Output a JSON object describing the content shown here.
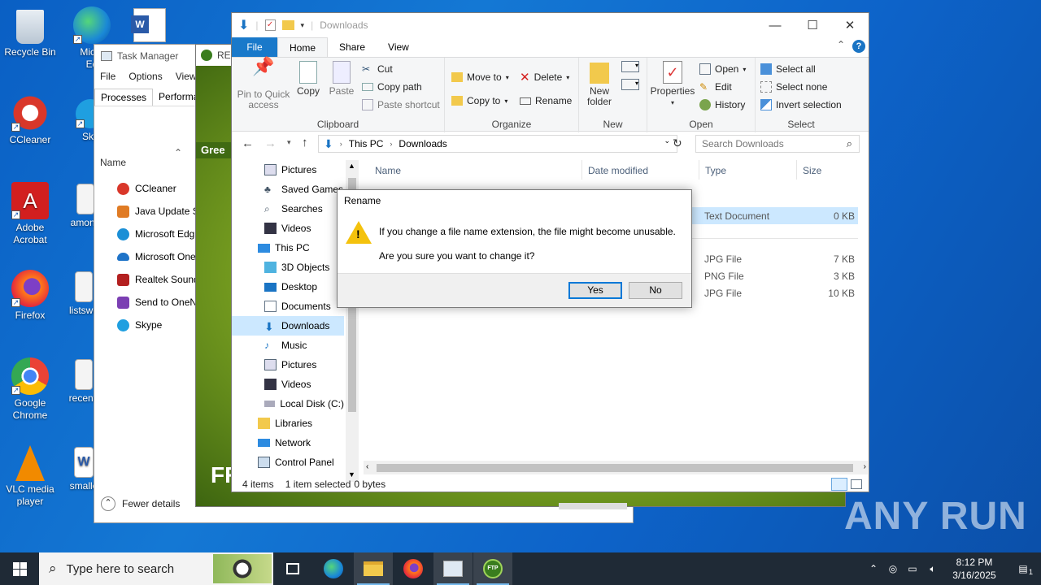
{
  "desktop": {
    "icons": [
      {
        "label": "Recycle Bin",
        "icon": "recycle-bin-icon"
      },
      {
        "label": "Micro\nEd",
        "icon": "edge-icon"
      },
      {
        "label": "CCleaner",
        "icon": "ccleaner-icon"
      },
      {
        "label": "Sky",
        "icon": "skype-icon"
      },
      {
        "label": "Adobe Acrobat",
        "icon": "acrobat-icon"
      },
      {
        "label": "among",
        "icon": "file-icon"
      },
      {
        "label": "Firefox",
        "icon": "firefox-icon"
      },
      {
        "label": "listswo",
        "icon": "file-icon"
      },
      {
        "label": "Google Chrome",
        "icon": "chrome-icon"
      },
      {
        "label": "recentf",
        "icon": "file-icon"
      },
      {
        "label": "VLC media player",
        "icon": "vlc-icon"
      },
      {
        "label": "smalle",
        "icon": "word-icon"
      }
    ]
  },
  "task_manager": {
    "title": "Task Manager",
    "menu": [
      "File",
      "Options",
      "View"
    ],
    "tabs": [
      "Processes",
      "Performan"
    ],
    "column": "Name",
    "items": [
      {
        "label": "CCleaner",
        "color": "#d9372a"
      },
      {
        "label": "Java Update Sc",
        "color": "#e07b24"
      },
      {
        "label": "Microsoft Edg",
        "color": "#1b8fd6"
      },
      {
        "label": "Microsoft One",
        "color": "#1e73c8"
      },
      {
        "label": "Realtek Sound",
        "color": "#b32020"
      },
      {
        "label": "Send to OneN",
        "color": "#7b3fb3"
      },
      {
        "label": "Skype",
        "color": "#1f9fe0"
      }
    ],
    "footer": "Fewer details"
  },
  "green_window": {
    "title": "REF",
    "band_text": "Gree",
    "bottom_text": "FR"
  },
  "explorer": {
    "title": "Downloads",
    "tabs": {
      "file": "File",
      "home": "Home",
      "share": "Share",
      "view": "View"
    },
    "ribbon": {
      "clipboard": {
        "pin": "Pin to Quick access",
        "copy": "Copy",
        "paste": "Paste",
        "cut": "Cut",
        "copy_path": "Copy path",
        "paste_shortcut": "Paste shortcut",
        "label": "Clipboard"
      },
      "organize": {
        "move_to": "Move to",
        "copy_to": "Copy to",
        "delete": "Delete",
        "rename": "Rename",
        "label": "Organize"
      },
      "new": {
        "new_folder": "New folder",
        "label": "New"
      },
      "open": {
        "properties": "Properties",
        "open": "Open",
        "edit": "Edit",
        "history": "History",
        "label": "Open"
      },
      "select": {
        "select_all": "Select all",
        "select_none": "Select none",
        "invert_selection": "Invert selection",
        "label": "Select"
      }
    },
    "address": {
      "segments": [
        "This PC",
        "Downloads"
      ],
      "search_placeholder": "Search Downloads"
    },
    "nav": [
      {
        "label": "Pictures",
        "icon": "pictures-icon",
        "indent": 1
      },
      {
        "label": "Saved Games",
        "icon": "saved-games-icon",
        "indent": 1
      },
      {
        "label": "Searches",
        "icon": "searches-icon",
        "indent": 1
      },
      {
        "label": "Videos",
        "icon": "videos-icon",
        "indent": 1
      },
      {
        "label": "This PC",
        "icon": "this-pc-icon",
        "indent": 0
      },
      {
        "label": "3D Objects",
        "icon": "3d-objects-icon",
        "indent": 1
      },
      {
        "label": "Desktop",
        "icon": "desktop-icon",
        "indent": 1
      },
      {
        "label": "Documents",
        "icon": "documents-icon",
        "indent": 1
      },
      {
        "label": "Downloads",
        "icon": "downloads-icon",
        "indent": 1,
        "selected": true
      },
      {
        "label": "Music",
        "icon": "music-icon",
        "indent": 1
      },
      {
        "label": "Pictures",
        "icon": "pictures-icon",
        "indent": 1
      },
      {
        "label": "Videos",
        "icon": "videos-icon",
        "indent": 1
      },
      {
        "label": "Local Disk (C:)",
        "icon": "disk-icon",
        "indent": 1
      },
      {
        "label": "Libraries",
        "icon": "libraries-icon",
        "indent": 0
      },
      {
        "label": "Network",
        "icon": "network-icon",
        "indent": 0
      },
      {
        "label": "Control Panel",
        "icon": "control-panel-icon",
        "indent": 0
      }
    ],
    "columns": {
      "name": "Name",
      "date": "Date modified",
      "type": "Type",
      "size": "Size"
    },
    "files": [
      {
        "type": "Text Document",
        "size": "0 KB",
        "selected": true
      },
      {
        "type": "JPG File",
        "size": "7 KB"
      },
      {
        "type": "PNG File",
        "size": "3 KB"
      },
      {
        "type": "JPG File",
        "size": "10 KB"
      }
    ],
    "status": {
      "items": "4 items",
      "selected": "1 item selected",
      "size": "0 bytes"
    }
  },
  "dialog": {
    "title": "Rename",
    "message": "If you change a file name extension, the file might become unusable.",
    "question": "Are you sure you want to change it?",
    "yes": "Yes",
    "no": "No"
  },
  "taskbar": {
    "search_placeholder": "Type here to search",
    "time": "8:12 PM",
    "date": "3/16/2025",
    "notification_count": "1"
  },
  "watermark": "ANY RUN"
}
